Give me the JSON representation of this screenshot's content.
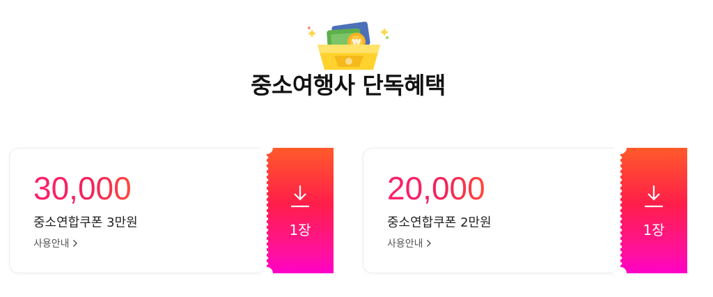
{
  "header": {
    "icon": "wallet-coins-icon",
    "title": "중소여행사 단독혜택"
  },
  "coupons": [
    {
      "amount": "30,000",
      "name": "중소연합쿠폰 3만원",
      "guide": "사용안내",
      "count": "1장",
      "icon": "download-icon"
    },
    {
      "amount": "20,000",
      "name": "중소연합쿠폰 2만원",
      "guide": "사용안내",
      "count": "1장",
      "icon": "download-icon"
    }
  ],
  "colors": {
    "amount_gradient": [
      "#ff1e6e",
      "#ff4a3a"
    ],
    "stub_gradient": [
      "#ff5a2a",
      "#ff1e4a",
      "#ff00c8"
    ],
    "title": "#111111"
  }
}
